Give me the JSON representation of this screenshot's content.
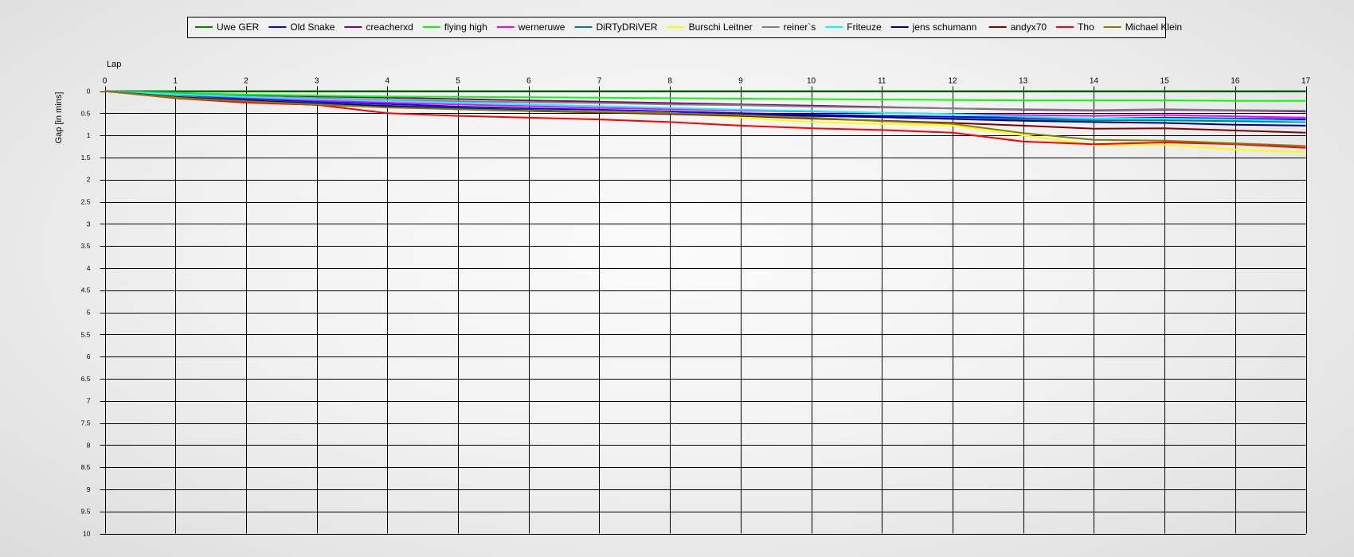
{
  "chart_data": {
    "type": "line",
    "xlabel": "Lap",
    "ylabel": "Gap [in mins]",
    "xlim": [
      0,
      17
    ],
    "ylim": [
      0,
      10
    ],
    "y_inverted": true,
    "x_ticks": [
      0,
      1,
      2,
      3,
      4,
      5,
      6,
      7,
      8,
      9,
      10,
      11,
      12,
      13,
      14,
      15,
      16,
      17
    ],
    "y_ticks": [
      "0",
      "0.5",
      "1",
      "1.5",
      "2",
      "2.5",
      "3",
      "3.5",
      "4",
      "4.5",
      "5",
      "5.5",
      "6",
      "6.5",
      "7",
      "7.5",
      "8",
      "8.5",
      "9",
      "9.5",
      "10"
    ],
    "grid": true,
    "legend_position": "top",
    "x": [
      0,
      1,
      2,
      3,
      4,
      5,
      6,
      7,
      8,
      9,
      10,
      11,
      12,
      13,
      14,
      15,
      16,
      17
    ],
    "series": [
      {
        "name": "Uwe GER",
        "color": "#008000",
        "values": [
          0,
          0,
          0,
          0,
          0,
          0,
          0,
          0,
          0,
          0,
          0,
          0,
          0,
          0,
          0,
          0,
          0,
          0
        ]
      },
      {
        "name": "Old Snake",
        "color": "#0000ff",
        "values": [
          0,
          0.09,
          0.17,
          0.24,
          0.29,
          0.35,
          0.39,
          0.42,
          0.46,
          0.5,
          0.53,
          0.56,
          0.58,
          0.6,
          0.62,
          0.6,
          0.62,
          0.64
        ]
      },
      {
        "name": "creacherxd",
        "color": "#800080",
        "values": [
          0,
          0.05,
          0.09,
          0.12,
          0.15,
          0.18,
          0.21,
          0.24,
          0.27,
          0.3,
          0.33,
          0.36,
          0.39,
          0.42,
          0.44,
          0.42,
          0.44,
          0.46
        ]
      },
      {
        "name": "flying high",
        "color": "#00ff00",
        "values": [
          0,
          0.04,
          0.08,
          0.1,
          0.12,
          0.13,
          0.14,
          0.15,
          0.16,
          0.17,
          0.18,
          0.19,
          0.2,
          0.21,
          0.21,
          0.21,
          0.22,
          0.22
        ]
      },
      {
        "name": "werneruwe",
        "color": "#ff00ff",
        "values": [
          0,
          0.08,
          0.15,
          0.21,
          0.26,
          0.3,
          0.34,
          0.38,
          0.41,
          0.44,
          0.46,
          0.49,
          0.52,
          0.54,
          0.56,
          0.54,
          0.57,
          0.6
        ]
      },
      {
        "name": "DiRTyDRiVER",
        "color": "#008080",
        "values": [
          0,
          0.11,
          0.2,
          0.27,
          0.33,
          0.38,
          0.42,
          0.46,
          0.5,
          0.53,
          0.56,
          0.59,
          0.62,
          0.64,
          0.66,
          0.66,
          0.68,
          0.7
        ]
      },
      {
        "name": "Burschi Leitner",
        "color": "#ffff00",
        "values": [
          0,
          0.12,
          0.22,
          0.29,
          0.35,
          0.4,
          0.43,
          0.46,
          0.49,
          0.6,
          0.7,
          0.74,
          0.78,
          1.0,
          1.22,
          1.22,
          1.32,
          1.38
        ]
      },
      {
        "name": "reiner`s",
        "color": "#808080",
        "values": [
          0,
          0.06,
          0.12,
          0.16,
          0.2,
          0.23,
          0.25,
          0.27,
          0.3,
          0.32,
          0.35,
          0.37,
          0.39,
          0.41,
          0.43,
          0.41,
          0.43,
          0.44
        ]
      },
      {
        "name": "Friteuze",
        "color": "#00ffff",
        "values": [
          0,
          0.07,
          0.13,
          0.18,
          0.22,
          0.26,
          0.3,
          0.34,
          0.38,
          0.42,
          0.45,
          0.49,
          0.52,
          0.58,
          0.62,
          0.62,
          0.64,
          0.68
        ]
      },
      {
        "name": "jens  schumann",
        "color": "#000080",
        "values": [
          0,
          0.13,
          0.21,
          0.28,
          0.34,
          0.39,
          0.43,
          0.47,
          0.5,
          0.53,
          0.56,
          0.59,
          0.63,
          0.67,
          0.7,
          0.72,
          0.76,
          0.78
        ]
      },
      {
        "name": "andyx70",
        "color": "#800000",
        "values": [
          0,
          0.14,
          0.25,
          0.31,
          0.36,
          0.41,
          0.45,
          0.48,
          0.52,
          0.56,
          0.62,
          0.67,
          0.72,
          0.78,
          0.85,
          0.84,
          0.89,
          0.94
        ]
      },
      {
        "name": "Tho",
        "color": "#ff0000",
        "values": [
          0,
          0.16,
          0.26,
          0.31,
          0.5,
          0.56,
          0.6,
          0.64,
          0.7,
          0.78,
          0.84,
          0.88,
          0.94,
          1.14,
          1.2,
          1.16,
          1.2,
          1.28
        ]
      },
      {
        "name": "Michael Klein",
        "color": "#808000",
        "values": [
          0,
          0.15,
          0.23,
          0.3,
          0.37,
          0.41,
          0.44,
          0.47,
          0.5,
          0.54,
          0.6,
          0.68,
          0.74,
          0.95,
          1.1,
          1.12,
          1.18,
          1.24
        ]
      }
    ]
  }
}
